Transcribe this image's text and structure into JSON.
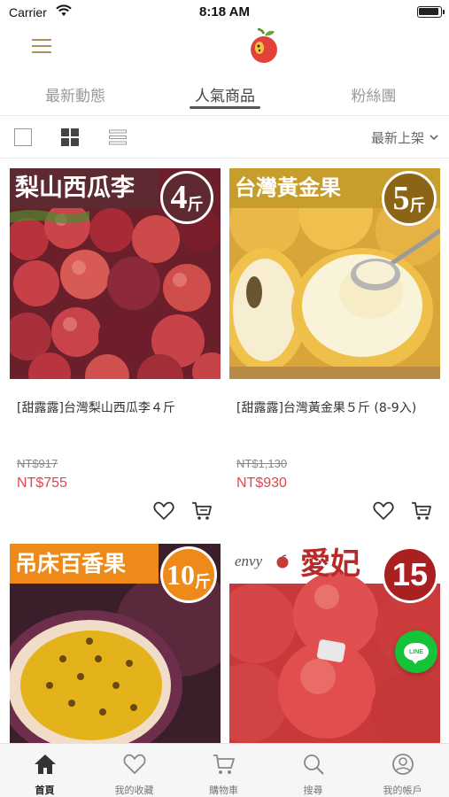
{
  "status_bar": {
    "carrier": "Carrier",
    "time": "8:18 AM"
  },
  "nav": {
    "menu_icon": "hamburger-icon",
    "logo_icon": "apple-logo-icon"
  },
  "tabs": [
    {
      "label": "最新動態",
      "active": false
    },
    {
      "label": "人氣商品",
      "active": true
    },
    {
      "label": "粉絲團",
      "active": false
    }
  ],
  "toolbar": {
    "sort_label": "最新上架"
  },
  "products": [
    {
      "banner": "梨山西瓜李",
      "badge_num": "4",
      "badge_unit": "斤",
      "name": "[甜露露]台灣梨山西瓜李４斤",
      "original_price": "NT$917",
      "sale_price": "NT$755"
    },
    {
      "banner": "台灣黃金果",
      "badge_num": "5",
      "badge_unit": "斤",
      "name": "[甜露露]台灣黃金果５斤 (8-9入)",
      "original_price": "NT$1,130",
      "sale_price": "NT$930"
    },
    {
      "banner": "吊床百香果",
      "badge_num": "10",
      "badge_unit": "斤"
    },
    {
      "brand": "envy",
      "banner": "愛妃",
      "badge_num": "15"
    }
  ],
  "line_button": {
    "label": "LINE"
  },
  "tabbar": [
    {
      "label": "首頁",
      "icon": "home-icon",
      "active": true
    },
    {
      "label": "我的收藏",
      "icon": "heart-icon",
      "active": false
    },
    {
      "label": "購物車",
      "icon": "cart-icon",
      "active": false
    },
    {
      "label": "搜尋",
      "icon": "search-icon",
      "active": false
    },
    {
      "label": "我的帳戶",
      "icon": "account-icon",
      "active": false
    }
  ],
  "colors": {
    "accent": "#a8915c",
    "sale": "#e0464c",
    "line_green": "#14c338"
  }
}
